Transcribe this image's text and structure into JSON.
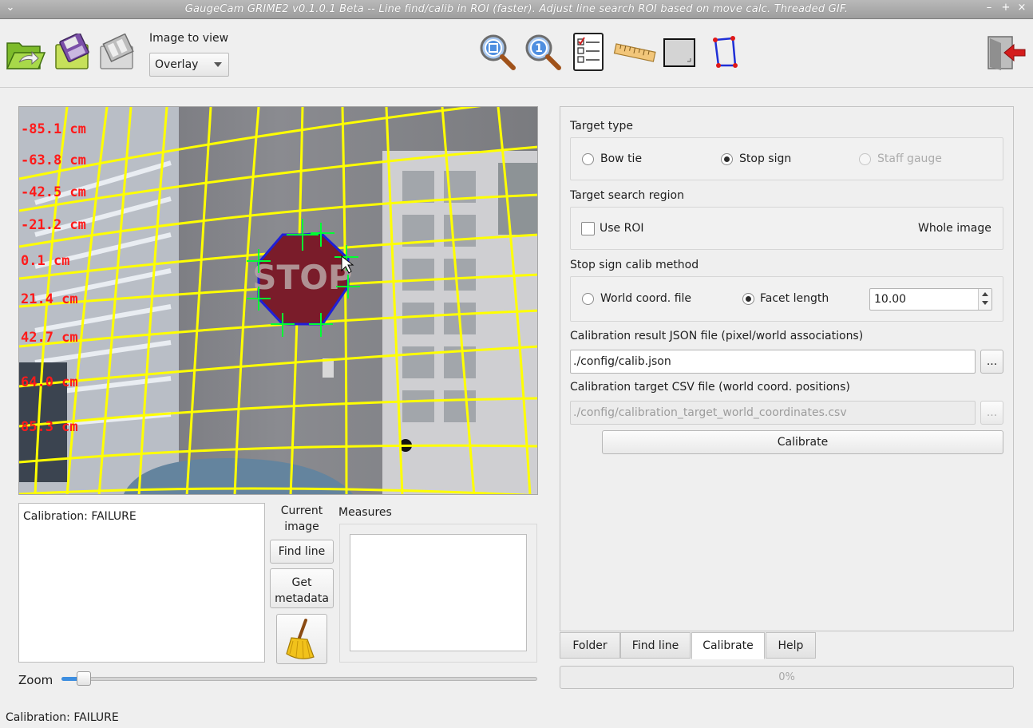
{
  "window": {
    "title": "GaugeCam GRIME2 v0.1.0.1 Beta -- Line find/calib in ROI (faster). Adjust line search ROI based on move calc. Threaded GIF.",
    "menu_glyph": "⌄",
    "min_glyph": "–",
    "max_glyph": "+",
    "close_glyph": "×"
  },
  "toolbar": {
    "image_to_view_label": "Image to view",
    "image_select_value": "Overlay",
    "icons": [
      "folder-open-icon",
      "save-icon",
      "filmstrip-icon",
      "zoom-fit-icon",
      "zoom-100-icon",
      "checklist-icon",
      "ruler-icon",
      "rectangle-icon",
      "quad-polygon-icon",
      "exit-icon"
    ]
  },
  "overlay": {
    "measure_labels": [
      "-85.1 cm",
      "-63.8 cm",
      "-42.5 cm",
      "-21.2 cm",
      "0.1 cm",
      "21.4 cm",
      "42.7 cm",
      "64.0 cm",
      "85.3 cm"
    ],
    "sign_text": "STOP"
  },
  "left_panel": {
    "log_text": "Calibration: FAILURE",
    "current_image_label": "Current image",
    "find_line_button": "Find line",
    "get_metadata_button": "Get metadata",
    "measures_label": "Measures",
    "zoom_label": "Zoom",
    "zoom_value": 0.04
  },
  "calibrate_panel": {
    "target_type_label": "Target type",
    "target_types": [
      {
        "label": "Bow tie",
        "selected": false,
        "enabled": true
      },
      {
        "label": "Stop sign",
        "selected": true,
        "enabled": true
      },
      {
        "label": "Staff gauge",
        "selected": false,
        "enabled": false
      }
    ],
    "search_region_label": "Target search region",
    "use_roi_label": "Use ROI",
    "use_roi_checked": false,
    "whole_image_label": "Whole image",
    "stop_sign_method_label": "Stop sign calib method",
    "world_coord_label": "World coord. file",
    "facet_length_label": "Facet length",
    "facet_length_value": "10.00",
    "result_json_label": "Calibration result JSON file (pixel/world associations)",
    "result_json_value": "./config/calib.json",
    "browse_label": "...",
    "target_csv_label": "Calibration target CSV file (world coord. positions)",
    "target_csv_value": "./config/calibration_target_world_coordinates.csv",
    "calibrate_button": "Calibrate"
  },
  "tabs": [
    {
      "label": "Folder",
      "active": false
    },
    {
      "label": "Find line",
      "active": false
    },
    {
      "label": "Calibrate",
      "active": true
    },
    {
      "label": "Help",
      "active": false
    }
  ],
  "progress": {
    "text": "0%",
    "value": 0
  },
  "status": {
    "text": "Calibration: FAILURE"
  },
  "colors": {
    "grid": "#ffff00",
    "labels": "#ff1a1a",
    "sign": "#7a1c2a",
    "sign_outline": "#1f1fd8",
    "markers": "#00ff33"
  }
}
